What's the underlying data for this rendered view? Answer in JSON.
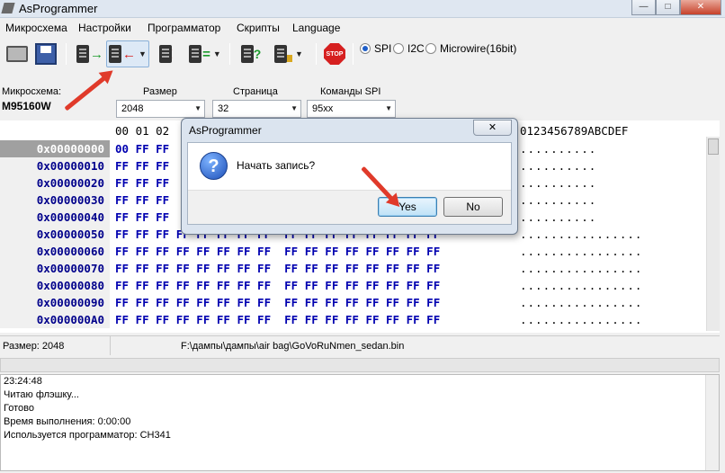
{
  "window": {
    "title": "AsProgrammer"
  },
  "menu": [
    "Микросхема",
    "Настройки",
    "Программатор",
    "Скрипты",
    "Language"
  ],
  "toolbar": {
    "icons": [
      "open-file-icon",
      "save-icon",
      "read-chip-icon",
      "write-chip-icon",
      "erase-chip-icon",
      "verify-chip-icon",
      "blank-check-icon",
      "lock-chip-icon",
      "stop-icon"
    ],
    "stop_label": "STOP",
    "protocols": [
      {
        "label": "SPI",
        "selected": true
      },
      {
        "label": "I2C",
        "selected": false
      },
      {
        "label": "Microwire(16bit)",
        "selected": false
      }
    ]
  },
  "chip": {
    "label": "Микросхема:",
    "name": "M95160W",
    "size_label": "Размер",
    "size_value": "2048",
    "page_label": "Страница",
    "page_value": "32",
    "spi_label": "Команды SPI",
    "spi_value": "95xx"
  },
  "hex": {
    "header_offsets": "00 01 02",
    "header_ascii": "0123456789ABCDEF",
    "rows": [
      {
        "addr": "0x00000000",
        "bytes": "00 FF FF",
        "ascii": ".........."
      },
      {
        "addr": "0x00000010",
        "bytes": "FF FF FF",
        "ascii": ".........."
      },
      {
        "addr": "0x00000020",
        "bytes": "FF FF FF",
        "ascii": ".........."
      },
      {
        "addr": "0x00000030",
        "bytes": "FF FF FF",
        "ascii": ".........."
      },
      {
        "addr": "0x00000040",
        "bytes": "FF FF FF",
        "ascii": ".........."
      },
      {
        "addr": "0x00000050",
        "bytes": "FF FF FF FF FF FF FF FF  FF FF FF FF FF FF FF FF",
        "ascii": "................"
      },
      {
        "addr": "0x00000060",
        "bytes": "FF FF FF FF FF FF FF FF  FF FF FF FF FF FF FF FF",
        "ascii": "................"
      },
      {
        "addr": "0x00000070",
        "bytes": "FF FF FF FF FF FF FF FF  FF FF FF FF FF FF FF FF",
        "ascii": "................"
      },
      {
        "addr": "0x00000080",
        "bytes": "FF FF FF FF FF FF FF FF  FF FF FF FF FF FF FF FF",
        "ascii": "................"
      },
      {
        "addr": "0x00000090",
        "bytes": "FF FF FF FF FF FF FF FF  FF FF FF FF FF FF FF FF",
        "ascii": "................"
      },
      {
        "addr": "0x000000A0",
        "bytes": "FF FF FF FF FF FF FF FF  FF FF FF FF FF FF FF FF",
        "ascii": "................"
      }
    ]
  },
  "status": {
    "size": "Размер: 2048",
    "path": "F:\\дампы\\дампы\\air bag\\GoVoRuNmen_sedan.bin"
  },
  "log": [
    "23:24:48",
    "Читаю флэшку...",
    "Готово",
    "Время выполнения: 0:00:00",
    "Используется программатор: CH341"
  ],
  "dialog": {
    "title": "AsProgrammer",
    "close": "✕",
    "message": "Начать запись?",
    "yes": "Yes",
    "no": "No"
  },
  "colors": {
    "annotation_arrow": "#e03a2a",
    "hex_bytes": "#0000b0"
  }
}
